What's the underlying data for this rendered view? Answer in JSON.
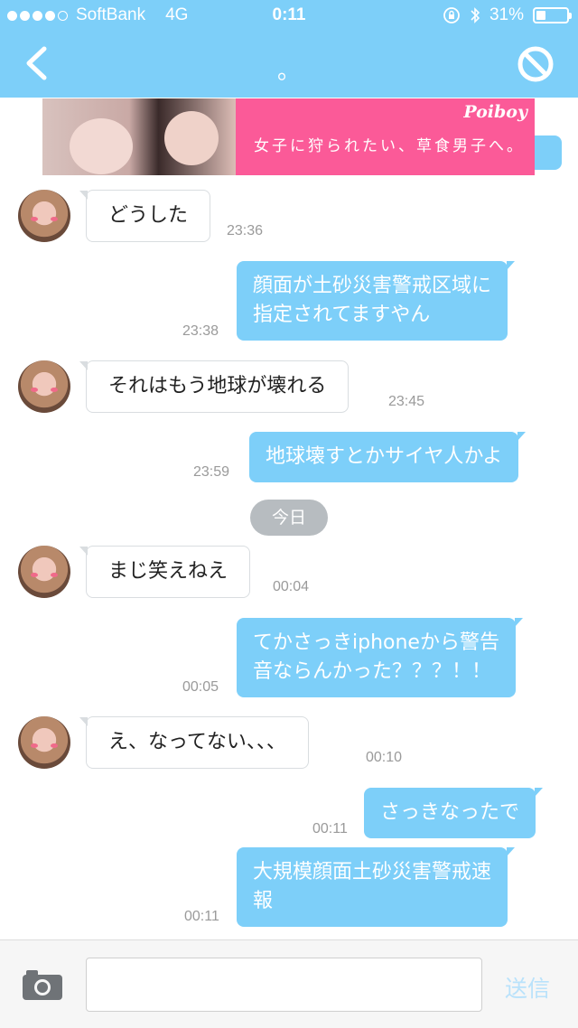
{
  "status_bar": {
    "carrier": "SoftBank",
    "network": "4G",
    "time": "0:11",
    "battery": "31%",
    "battery_level": 0.31,
    "signal_bars": 4,
    "signal_max": 5,
    "icons": [
      "orientation-lock-icon",
      "bluetooth-icon",
      "battery-icon"
    ]
  },
  "nav": {
    "title": "。",
    "back_icon": "chevron-left-icon",
    "block_icon": "block-icon"
  },
  "ad": {
    "logo": "Poiboy",
    "text": "女子に狩られたい、草食男子へ。"
  },
  "messages": [
    {
      "side": "in",
      "text": "どうした",
      "time": "23:36"
    },
    {
      "side": "out",
      "lines": [
        "顔面が土砂災害警戒区域に",
        "指定されてますやん"
      ],
      "time": "23:38"
    },
    {
      "side": "in",
      "text": "それはもう地球が壊れる",
      "time": "23:45"
    },
    {
      "side": "out",
      "text": "地球壊すとかサイヤ人かよ",
      "time": "23:59"
    },
    {
      "side": "in",
      "text": "まじ笑えねえ",
      "time": "00:04"
    },
    {
      "side": "out",
      "lines": [
        "てかさっきiphoneから警告",
        "音ならんかった？？？！！"
      ],
      "time": "00:05"
    },
    {
      "side": "in",
      "text": "え、なってない、、、",
      "time": "00:10"
    },
    {
      "side": "out",
      "text": "さっきなったで",
      "time": "00:11"
    },
    {
      "side": "out",
      "lines": [
        "大規模顔面土砂災害警戒速",
        "報"
      ],
      "time": "00:11"
    }
  ],
  "date_divider": "今日",
  "composer": {
    "placeholder": "",
    "send_label": "送信",
    "camera_icon": "camera-icon"
  },
  "colors": {
    "accent": "#7dcff9",
    "ad_pink": "#fb5a98",
    "send_disabled": "#b9e2fb",
    "timestamp": "#9a9a9a",
    "date_pill": "#b7bcc0"
  }
}
